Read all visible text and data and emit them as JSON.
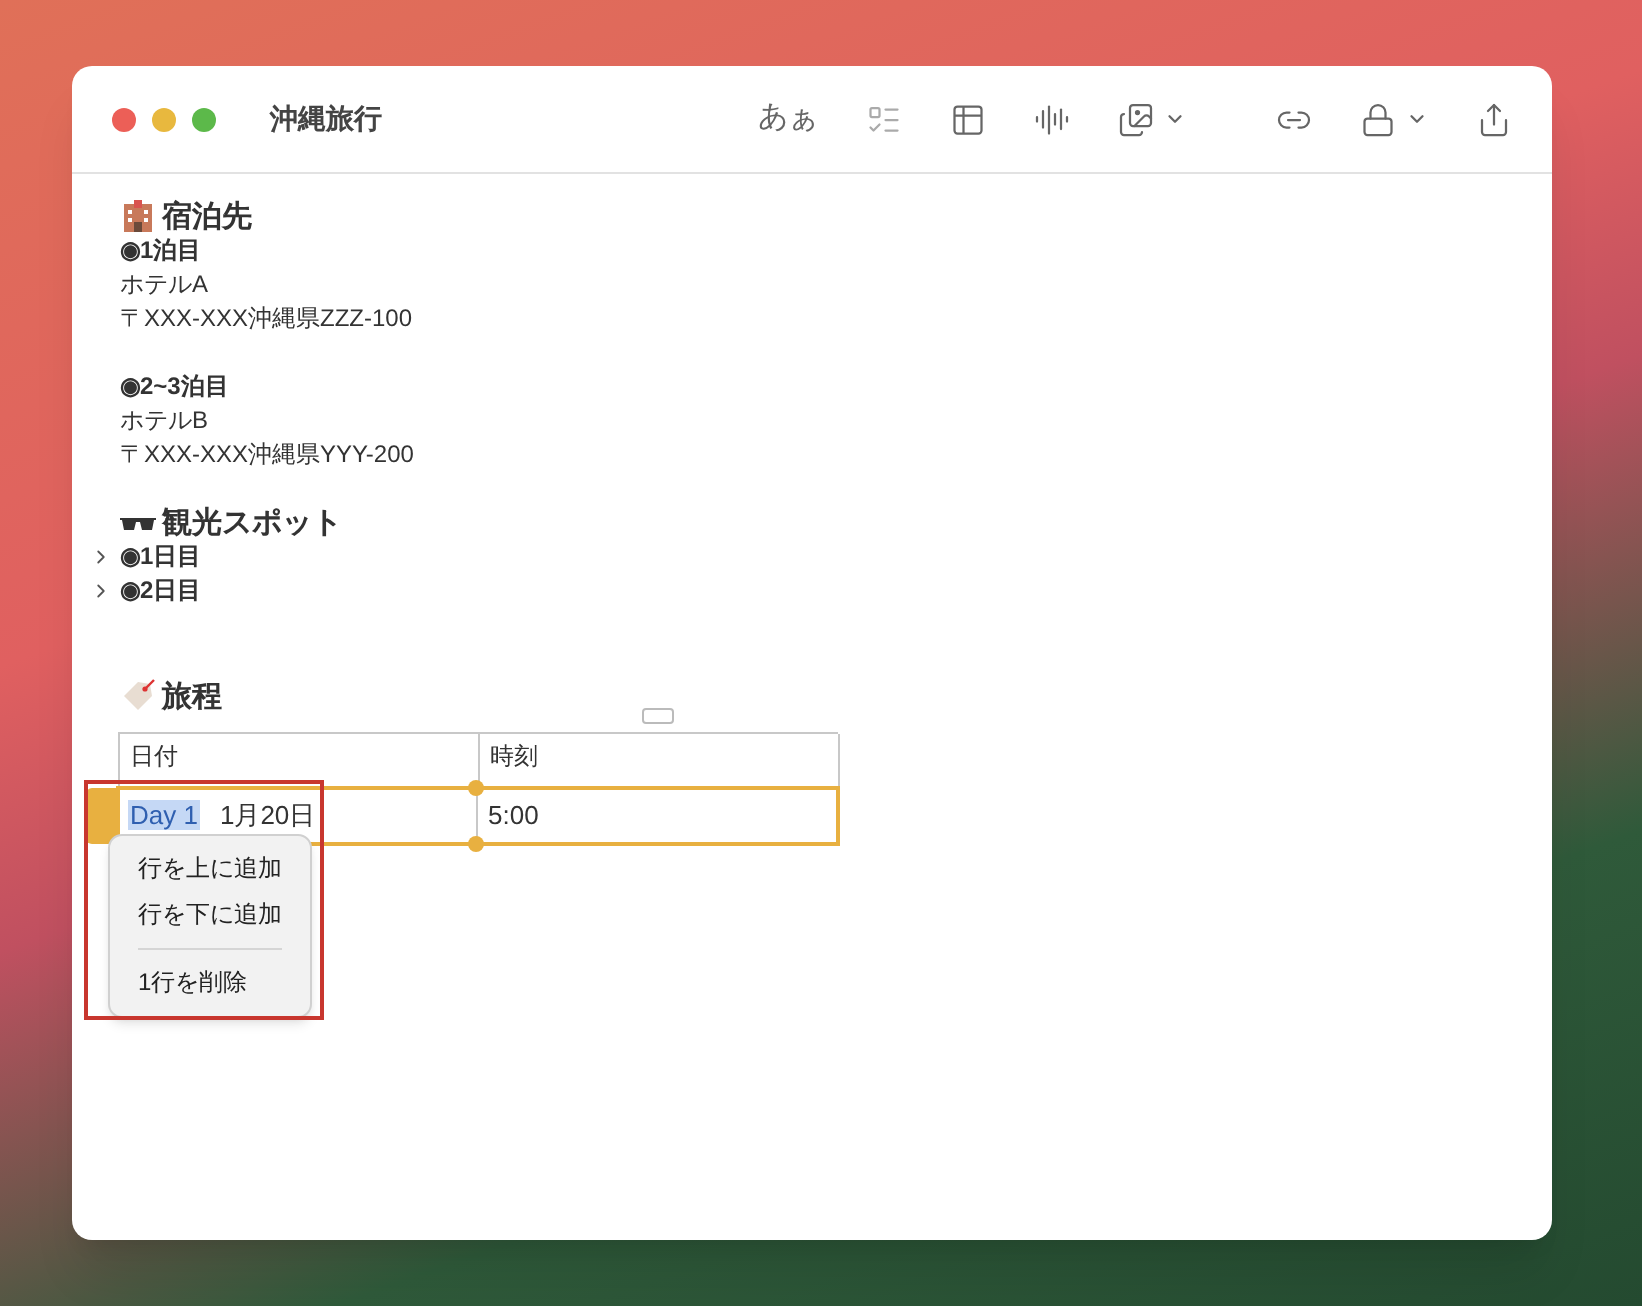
{
  "window": {
    "title": "沖縄旅行"
  },
  "toolbar": [
    {
      "kind": "text",
      "label": "あぁ"
    },
    {
      "kind": "checklist"
    },
    {
      "kind": "table"
    },
    {
      "kind": "audio"
    },
    {
      "kind": "media",
      "dropdown": true
    },
    {
      "kind": "collaborate"
    },
    {
      "kind": "lock",
      "dropdown": true
    },
    {
      "kind": "share"
    }
  ],
  "sections": [
    {
      "kind": "hotel",
      "title": "宿泊先",
      "groups": [
        {
          "title": "◉1泊目",
          "lines": [
            "ホテルA",
            "〒XXX-XXX沖縄県ZZZ-100"
          ]
        },
        {
          "title": "◉2~3泊目",
          "lines": [
            "ホテルB",
            "〒XXX-XXX沖縄県YYY-200"
          ]
        }
      ]
    },
    {
      "kind": "glasses",
      "title": "観光スポット",
      "items": [
        {
          "label": "◉1日目",
          "expanded": false
        },
        {
          "label": "◉2日目",
          "expanded": false
        }
      ]
    },
    {
      "kind": "tag",
      "title": "旅程",
      "table": {
        "columns": [
          "日付",
          "時刻"
        ],
        "rows": [
          {
            "selected": true,
            "cells": [
              {
                "highlight": "Day 1",
                "text": "1月20日"
              },
              {
                "text": "5:00"
              }
            ]
          }
        ]
      }
    }
  ],
  "context_menu": [
    {
      "kind": "item",
      "label": "行を上に追加"
    },
    {
      "kind": "item",
      "label": "行を下に追加"
    },
    {
      "kind": "separator"
    },
    {
      "kind": "item",
      "label": "1行を削除"
    }
  ]
}
